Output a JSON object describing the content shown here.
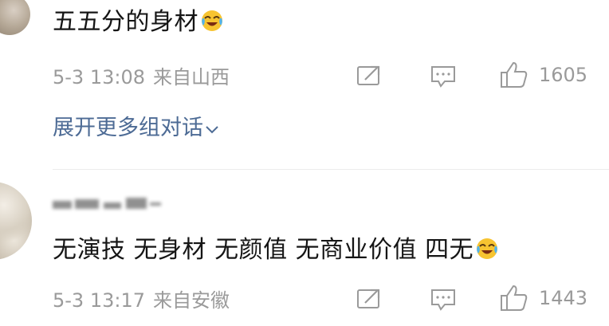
{
  "comments": [
    {
      "text": "五五分的身材",
      "emoji": "crying-laughing-face",
      "time": "5-3 13:08",
      "location": "来自山西",
      "likes": "1605"
    },
    {
      "text": "无演技 无身材 无颜值  无商业价值 四无",
      "emoji": "crying-laughing-face",
      "time": "5-3 13:17",
      "location": "来自安徽",
      "likes": "1443"
    }
  ],
  "expand_replies": "展开更多组对话",
  "icons": {
    "share": "share-icon",
    "reply": "comment-icon",
    "like": "thumbs-up-icon",
    "expand": "chevron-down-icon"
  },
  "colors": {
    "link": "#4d6b95",
    "meta": "#9a9a9a",
    "text": "#151515"
  }
}
